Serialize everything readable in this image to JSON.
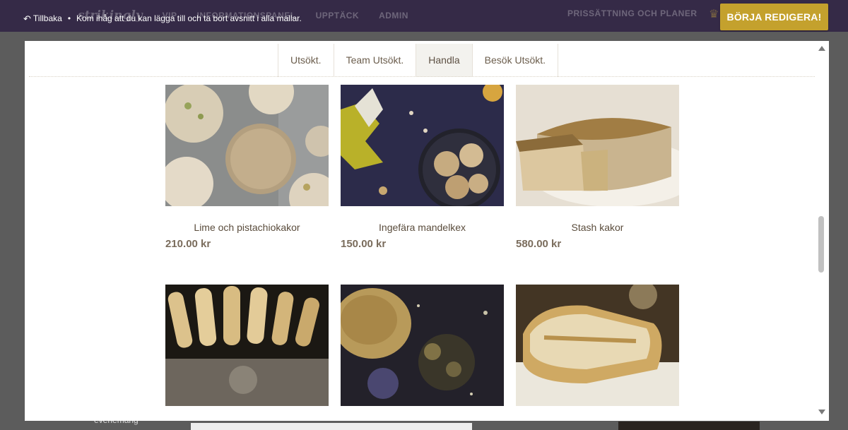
{
  "colors": {
    "topbar": "#352a47",
    "accent": "#c4a12d",
    "frame": "#ffffff",
    "backdrop": "#5c5c5c"
  },
  "topbar": {
    "back_icon": "undo-arrow-icon",
    "back_label": "Tillbaka",
    "separator": "•",
    "message": "Kom ihåg att du kan lägga till och ta bort avsnitt i alla mallar.",
    "cta_label": "BÖRJA REDIGERA!",
    "background_nav": {
      "logo": "strikingly",
      "items": [
        "VIP",
        "INFORMATIONSPANEL",
        "UPPTÄCK",
        "ADMIN"
      ],
      "pricing": "PRISSÄTTNING OCH PLANER",
      "crown_icon": "crown-icon"
    }
  },
  "tabs": [
    {
      "label": "Utsökt."
    },
    {
      "label": "Team Utsökt."
    },
    {
      "label": "Handla",
      "active": true
    },
    {
      "label": "Besök Utsökt."
    }
  ],
  "products": [
    {
      "name": "Lime och pistachiokakor",
      "price": "210.00 kr"
    },
    {
      "name": "Ingefära mandelkex",
      "price": "150.00 kr"
    },
    {
      "name": "Stash kakor",
      "price": "580.00 kr"
    },
    {
      "name": "",
      "price": ""
    },
    {
      "name": "",
      "price": ""
    },
    {
      "name": "",
      "price": ""
    }
  ],
  "background_page": {
    "partial_text": "evenemang"
  },
  "scrollbar": {
    "position": 0.52
  }
}
